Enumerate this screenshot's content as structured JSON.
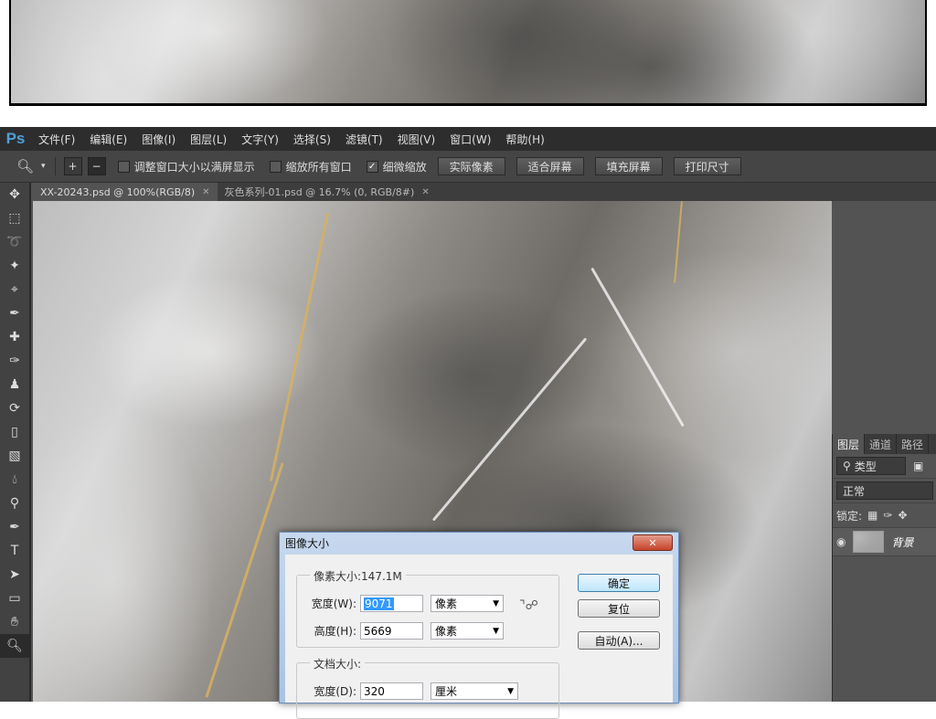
{
  "app": {
    "logo": "Ps"
  },
  "menu": [
    "文件(F)",
    "编辑(E)",
    "图像(I)",
    "图层(L)",
    "文字(Y)",
    "选择(S)",
    "滤镜(T)",
    "视图(V)",
    "窗口(W)",
    "帮助(H)"
  ],
  "options": {
    "resize_windows_label": "调整窗口大小以满屏显示",
    "resize_windows_checked": false,
    "zoom_all_label": "缩放所有窗口",
    "zoom_all_checked": false,
    "scrubby_zoom_label": "细微缩放",
    "scrubby_zoom_checked": true,
    "buttons": [
      "实际像素",
      "适合屏幕",
      "填充屏幕",
      "打印尺寸"
    ]
  },
  "tabs": [
    {
      "label": "XX-20243.psd @ 100%(RGB/8)",
      "active": true
    },
    {
      "label": "灰色系列-01.psd @ 16.7% (0, RGB/8#)",
      "active": false
    }
  ],
  "panel": {
    "tabs": [
      "图层",
      "通道",
      "路径"
    ],
    "filter_value": "类型",
    "blend_mode": "正常",
    "lock_label": "锁定:",
    "layer_name": "背景"
  },
  "dialog": {
    "title": "图像大小",
    "pixel_dimensions_label": "像素大小:147.1M",
    "width_label": "宽度(W):",
    "width_value": "9071",
    "width_unit": "像素",
    "height_label": "高度(H):",
    "height_value": "5669",
    "height_unit": "像素",
    "doc_size_label": "文档大小:",
    "doc_width_label": "宽度(D):",
    "doc_width_value": "320",
    "doc_width_unit": "厘米",
    "ok_label": "确定",
    "reset_label": "复位",
    "auto_label": "自动(A)..."
  },
  "colors": {
    "menubar": "#2d2d2d",
    "optionsbar": "#454545",
    "workspace": "#535353",
    "ps_logo": "#4fa0d8"
  }
}
